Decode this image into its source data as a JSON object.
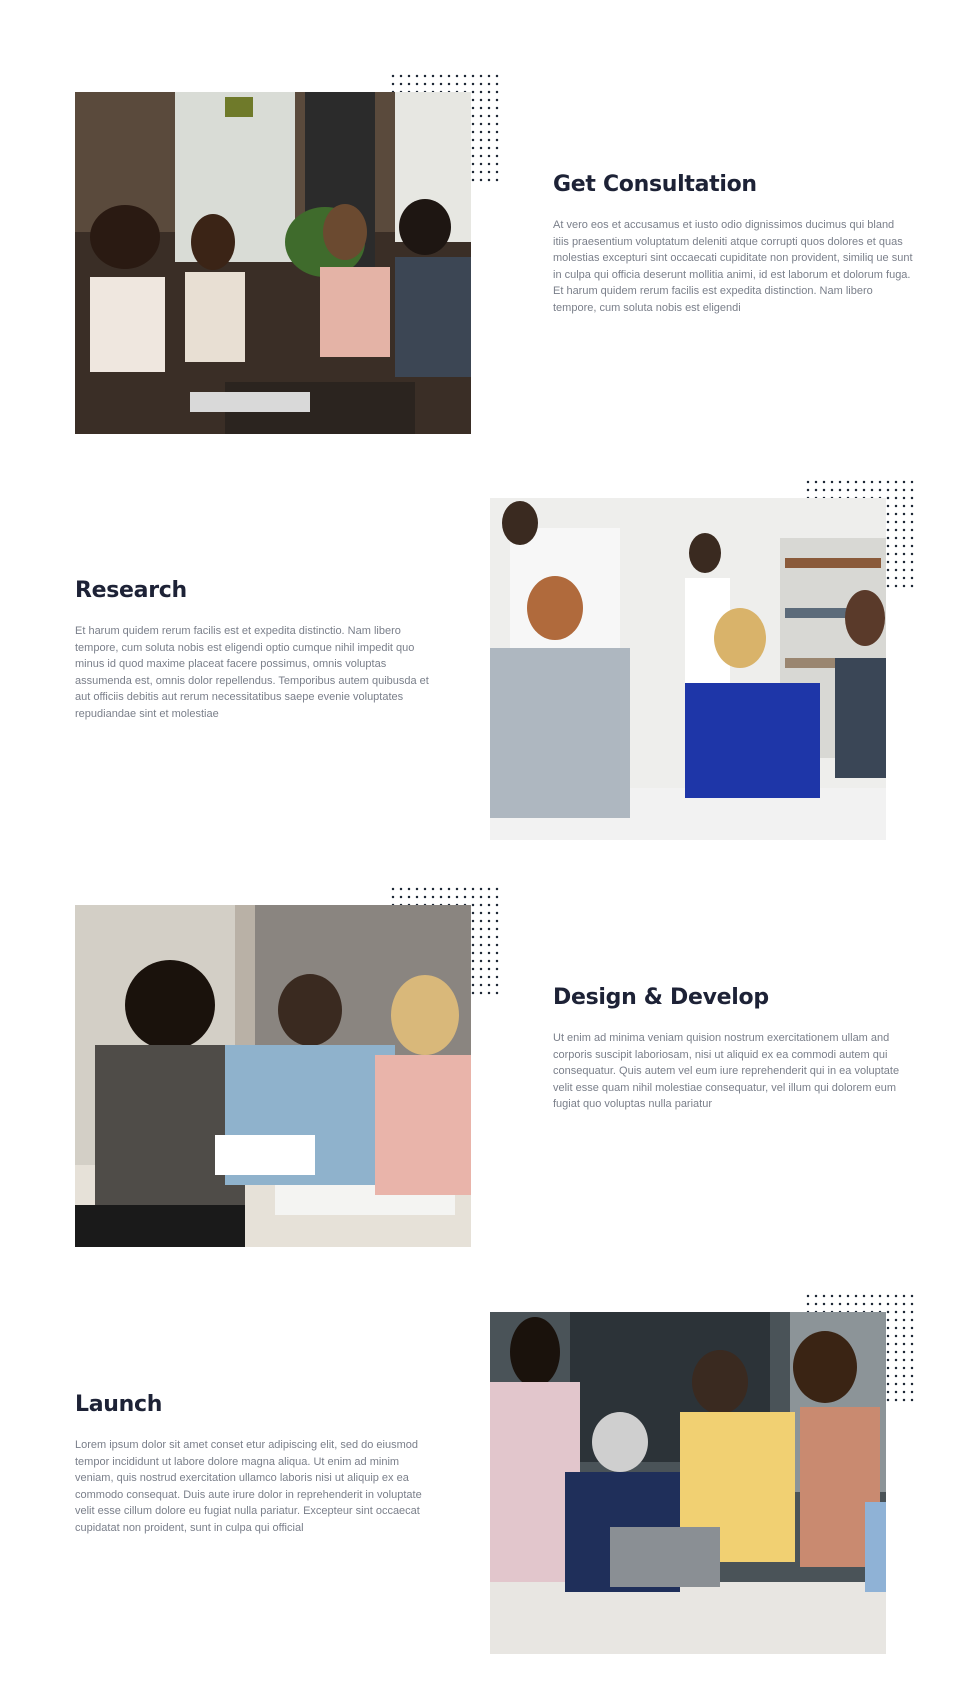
{
  "sections": [
    {
      "title": "Get Consultation",
      "body": "At vero eos et accusamus et iusto odio dignissimos ducimus qui bland itiis praesentium voluptatum deleniti atque corrupti quos dolores et quas molestias excepturi sint occaecati cupiditate non provident, similiq ue sunt in culpa qui officia deserunt mollitia animi, id est laborum et dolorum fuga. Et harum quidem rerum facilis est expedita distinction. Nam libero tempore, cum soluta nobis est eligendi",
      "image_icon": "team-meeting-photo"
    },
    {
      "title": "Research",
      "body": "Et harum quidem rerum facilis est et expedita distinctio. Nam libero tempore, cum soluta nobis est eligendi optio cumque nihil impedit quo minus id quod maxime placeat facere possimus, omnis voluptas assumenda est, omnis dolor repellendus. Temporibus autem quibusda et aut officiis debitis aut rerum necessitatibus saepe evenie voluptates repudiandae sint et molestiae",
      "image_icon": "office-discussion-photo"
    },
    {
      "title": "Design & Develop",
      "body": "Ut enim ad minima veniam quision nostrum exercitationem ullam and corporis suscipit laboriosam, nisi ut aliquid ex ea commodi autem qui consequatur. Quis autem vel eum iure reprehenderit qui in ea voluptate velit esse quam nihil molestiae consequatur, vel illum qui dolorem eum fugiat quo voluptas nulla pariatur",
      "image_icon": "design-meeting-photo"
    },
    {
      "title": "Launch",
      "body": "Lorem ipsum dolor sit amet conset etur adipiscing elit, sed do eiusmod tempor incididunt ut labore dolore magna aliqua. Ut enim ad minim veniam, quis nostrud exercitation ullamco laboris nisi ut aliquip ex ea commodo consequat. Duis aute irure dolor in reprehenderit in voluptate velit esse cillum dolore eu fugiat nulla pariatur. Excepteur sint occaecat cupidatat non proident, sunt in culpa qui official",
      "image_icon": "team-laptop-photo"
    }
  ],
  "colors": {
    "heading": "#1d2236",
    "body": "#7a7f8a",
    "dots": "#1f2937"
  }
}
